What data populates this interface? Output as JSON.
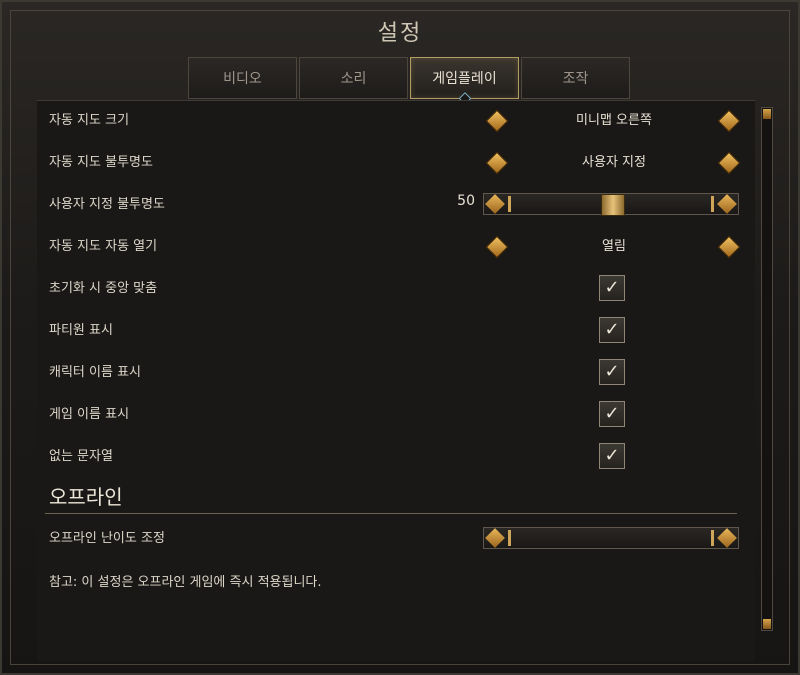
{
  "window": {
    "title": "설정"
  },
  "tabs": [
    {
      "label": "비디오",
      "active": false
    },
    {
      "label": "소리",
      "active": false
    },
    {
      "label": "게임플레이",
      "active": true
    },
    {
      "label": "조작",
      "active": false
    }
  ],
  "settings": {
    "minimap_size": {
      "label": "자동 지도 크기",
      "value": "미니맵 오른쪽"
    },
    "minimap_opacity": {
      "label": "자동 지도 불투명도",
      "value": "사용자 지정"
    },
    "custom_opacity": {
      "label": "사용자 지정 불투명도",
      "value": "50",
      "fraction": 0.5
    },
    "auto_open": {
      "label": "자동 지도 자동 열기",
      "value": "열림"
    },
    "center_on_reset": {
      "label": "초기화 시 중앙 맞춤",
      "checked": true
    },
    "show_party": {
      "label": "파티원 표시",
      "checked": true
    },
    "show_character_names": {
      "label": "캐릭터 이름 표시",
      "checked": true
    },
    "show_game_names": {
      "label": "게임 이름 표시",
      "checked": true
    },
    "empty_string": {
      "label": "없는 문자열",
      "checked": true
    }
  },
  "offline": {
    "section_title": "오프라인",
    "difficulty_label": "오프라인 난이도 조정",
    "difficulty_fraction": 0.0,
    "note": "참고: 이 설정은 오프라인 게임에 즉시 적용됩니다."
  },
  "icons": {
    "check": "✓",
    "arrow_left": "diamond-left-arrow-icon",
    "arrow_right": "diamond-right-arrow-icon"
  },
  "colors": {
    "accent_gold": "#d7a54c",
    "panel": "#1a1816",
    "text": "#ddd7ca"
  }
}
